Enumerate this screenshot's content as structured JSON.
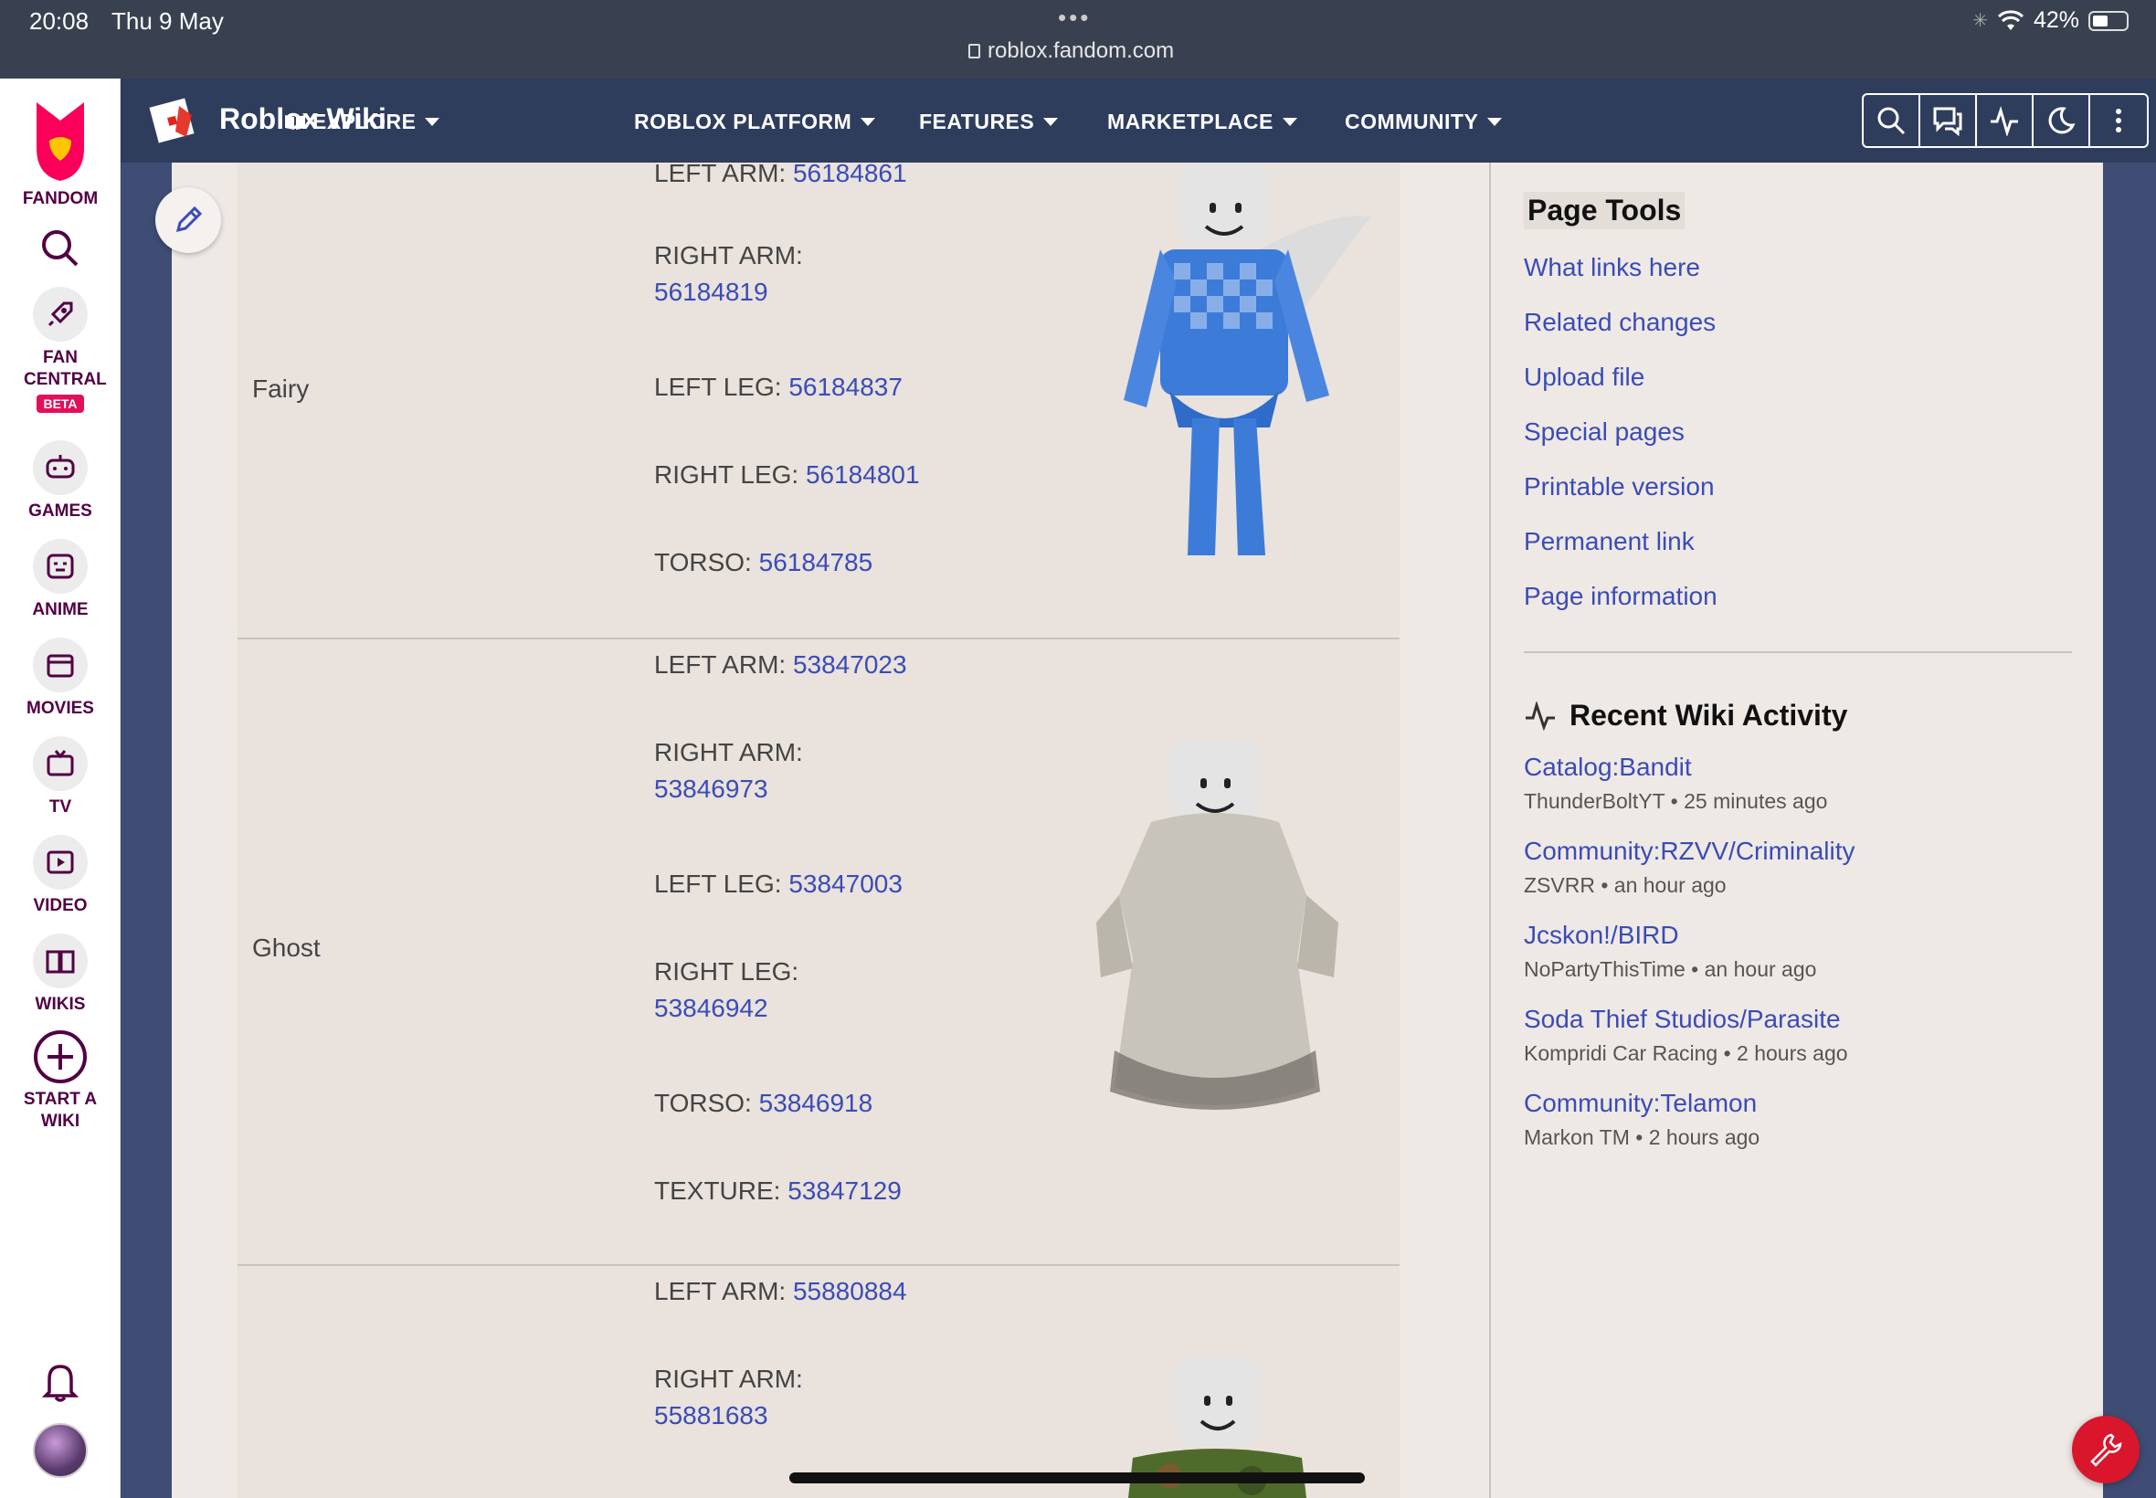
{
  "status_bar": {
    "time": "20:08",
    "date": "Thu 9 May",
    "url": "roblox.fandom.com",
    "battery": "42%"
  },
  "fandom_sidebar": {
    "logo_label": "FANDOM",
    "items": [
      {
        "label": "FAN CENTRAL",
        "badge": "BETA",
        "icon": "rocket-icon"
      },
      {
        "label": "GAMES",
        "icon": "gamepad-icon"
      },
      {
        "label": "ANIME",
        "icon": "anime-face-icon"
      },
      {
        "label": "MOVIES",
        "icon": "movie-icon"
      },
      {
        "label": "TV",
        "icon": "tv-icon"
      },
      {
        "label": "VIDEO",
        "icon": "video-play-icon"
      },
      {
        "label": "WIKIS",
        "icon": "book-icon"
      },
      {
        "label": "START A WIKI",
        "icon": "plus-circle-icon"
      }
    ]
  },
  "wiki_nav": {
    "title": "Roblox Wiki",
    "items": [
      {
        "label": "EXPLORE"
      },
      {
        "label": "ROBLOX PLATFORM"
      },
      {
        "label": "FEATURES"
      },
      {
        "label": "MARKETPLACE"
      },
      {
        "label": "COMMUNITY"
      }
    ],
    "tools": [
      "search-icon",
      "discussions-icon",
      "activity-icon",
      "dark-mode-icon",
      "more-icon"
    ]
  },
  "table_rows": [
    {
      "name": "Fairy",
      "parts": [
        {
          "label": "LEFT ARM: ",
          "id": "56184861"
        },
        {
          "label": "RIGHT ARM:",
          "id": "56184819"
        },
        {
          "label": "LEFT LEG: ",
          "id": "56184837"
        },
        {
          "label": "RIGHT LEG: ",
          "id": "56184801"
        },
        {
          "label": "TORSO: ",
          "id": "56184785"
        }
      ]
    },
    {
      "name": "Ghost",
      "parts": [
        {
          "label": "LEFT ARM: ",
          "id": "53847023"
        },
        {
          "label": "RIGHT ARM:",
          "id": "53846973"
        },
        {
          "label": "LEFT LEG: ",
          "id": "53847003"
        },
        {
          "label": "RIGHT LEG:",
          "id": "53846942"
        },
        {
          "label": "TORSO: ",
          "id": "53846918"
        },
        {
          "label": "TEXTURE: ",
          "id": "53847129"
        }
      ]
    },
    {
      "name": "",
      "parts": [
        {
          "label": "LEFT ARM: ",
          "id": "55880884"
        },
        {
          "label": "RIGHT ARM:",
          "id": "55881683"
        }
      ]
    }
  ],
  "page_tools": {
    "title": "Page Tools",
    "links": [
      "What links here",
      "Related changes",
      "Upload file",
      "Special pages",
      "Printable version",
      "Permanent link",
      "Page information"
    ]
  },
  "recent_activity": {
    "title": "Recent Wiki Activity",
    "items": [
      {
        "page": "Catalog:Bandit",
        "user": "ThunderBoltYT",
        "when": "25 minutes ago"
      },
      {
        "page": "Community:RZVV/Criminality",
        "user": "ZSVRR",
        "when": "an hour ago"
      },
      {
        "page": "Jcskon!/BIRD",
        "user": "NoPartyThisTime",
        "when": "an hour ago"
      },
      {
        "page": "Soda Thief Studios/Parasite",
        "user": "Kompridi Car Racing",
        "when": "2 hours ago"
      },
      {
        "page": "Community:Telamon",
        "user": "Markon TM",
        "when": "2 hours ago"
      }
    ]
  },
  "colors": {
    "link": "#3a4cb6",
    "nav_bg": "#2f3d5d",
    "fandom_accent": "#fa005a",
    "content_bg": "#efe9e5"
  }
}
